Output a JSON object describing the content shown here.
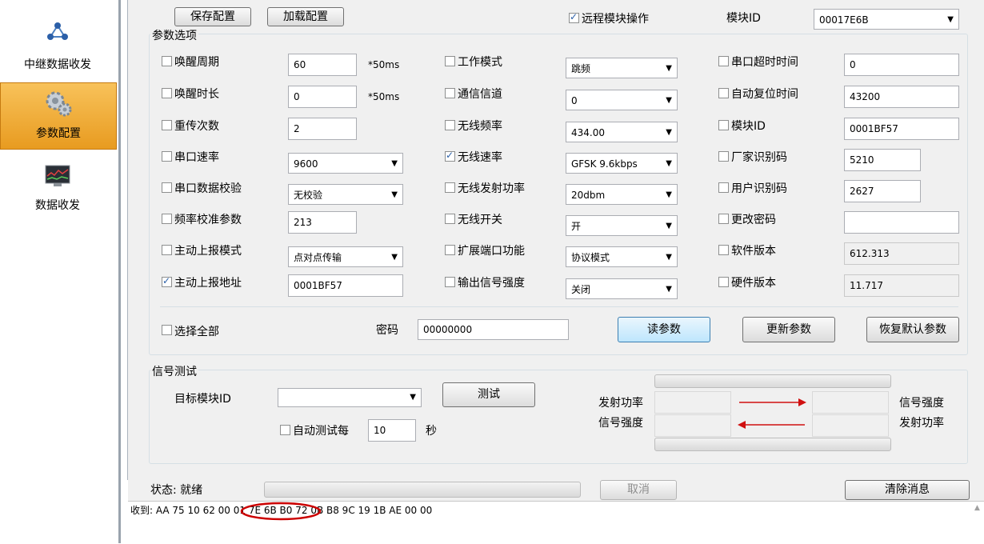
{
  "sidebar": {
    "items": [
      {
        "label": "中继数据收发",
        "icon": "relay-network-icon"
      },
      {
        "label": "参数配置",
        "icon": "gears-icon"
      },
      {
        "label": "数据收发",
        "icon": "monitor-chart-icon"
      }
    ]
  },
  "toolbar": {
    "save_label": "保存配置",
    "load_label": "加载配置",
    "remote_label": "远程模块操作",
    "module_id_label": "模块ID",
    "module_id_value": "00017E6B"
  },
  "params": {
    "title": "参数选项",
    "col1": [
      {
        "label": "唤醒周期",
        "value": "60",
        "unit": "*50ms",
        "checked": false,
        "type": "text"
      },
      {
        "label": "唤醒时长",
        "value": "0",
        "unit": "*50ms",
        "checked": false,
        "type": "text"
      },
      {
        "label": "重传次数",
        "value": "2",
        "unit": "",
        "checked": false,
        "type": "text"
      },
      {
        "label": "串口速率",
        "value": "9600",
        "unit": "",
        "checked": false,
        "type": "select"
      },
      {
        "label": "串口数据校验",
        "value": "无校验",
        "unit": "",
        "checked": false,
        "type": "select"
      },
      {
        "label": "频率校准参数",
        "value": "213",
        "unit": "",
        "checked": false,
        "type": "text"
      },
      {
        "label": "主动上报模式",
        "value": "点对点传输",
        "unit": "",
        "checked": false,
        "type": "select"
      },
      {
        "label": "主动上报地址",
        "value": "0001BF57",
        "unit": "",
        "checked": true,
        "type": "text"
      }
    ],
    "col2": [
      {
        "label": "工作模式",
        "value": "跳频",
        "checked": false
      },
      {
        "label": "通信信道",
        "value": "0",
        "checked": false
      },
      {
        "label": "无线频率",
        "value": "434.00",
        "checked": false
      },
      {
        "label": "无线速率",
        "value": "GFSK 9.6kbps",
        "checked": true
      },
      {
        "label": "无线发射功率",
        "value": "20dbm",
        "checked": false
      },
      {
        "label": "无线开关",
        "value": "开",
        "checked": false
      },
      {
        "label": "扩展端口功能",
        "value": "协议模式",
        "checked": false
      },
      {
        "label": "输出信号强度",
        "value": "关闭",
        "checked": false
      }
    ],
    "col3": [
      {
        "label": "串口超时时间",
        "value": "0",
        "checked": false
      },
      {
        "label": "自动复位时间",
        "value": "43200",
        "checked": false
      },
      {
        "label": "模块ID",
        "value": "0001BF57",
        "checked": false
      },
      {
        "label": "厂家识别码",
        "value": "5210",
        "checked": false
      },
      {
        "label": "用户识别码",
        "value": "2627",
        "checked": false
      },
      {
        "label": "更改密码",
        "value": "",
        "checked": false
      },
      {
        "label": "软件版本",
        "value": "612.313",
        "checked": false
      },
      {
        "label": "硬件版本",
        "value": "11.717",
        "checked": false
      }
    ],
    "select_all_label": "选择全部",
    "password_label": "密码",
    "password_value": "00000000",
    "read_label": "读参数",
    "update_label": "更新参数",
    "restore_label": "恢复默认参数"
  },
  "signal": {
    "title": "信号测试",
    "target_label": "目标模块ID",
    "target_value": "",
    "test_label": "测试",
    "auto_label": "自动测试每",
    "auto_value": "10",
    "sec_label": "秒",
    "tx_power_left": "发射功率",
    "rssi_left": "信号强度",
    "rssi_right": "信号强度",
    "tx_power_right": "发射功率"
  },
  "status": {
    "label": "状态: 就绪",
    "cancel_label": "取消",
    "clear_label": "清除消息",
    "log_line": "收到: AA 75 10 62 00 01 7E 6B B0 72 0B B8 9C 19 1B AE 00 00"
  },
  "colors": {
    "accent": "#e89b20",
    "highlight": "#cc0000"
  }
}
